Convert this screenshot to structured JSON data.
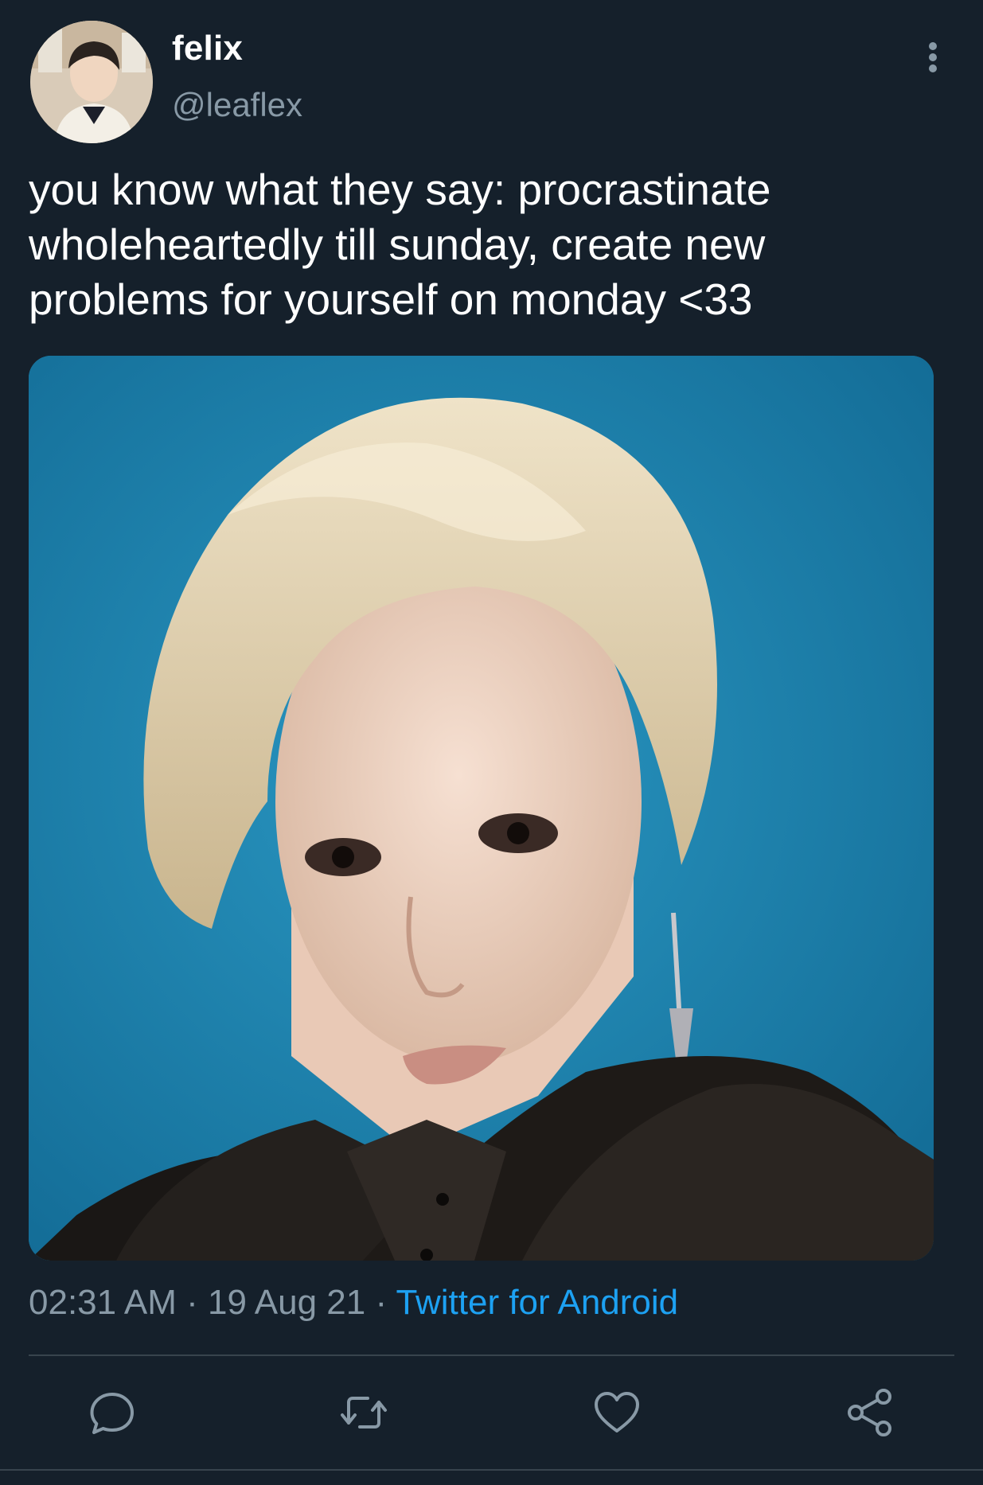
{
  "author": {
    "display_name": "felix",
    "handle": "@leaflex",
    "avatar_icon": "profile-photo"
  },
  "tweet": {
    "text": "you know what they say: procrastinate\nwholeheartedly till sunday, create new\nproblems for yourself on monday <33",
    "media": {
      "kind": "photo",
      "background_color": "#1f86b0"
    }
  },
  "meta": {
    "time": "02:31 AM",
    "separator": " · ",
    "date": "19 Aug 21",
    "source": "Twitter for Android"
  },
  "actions": [
    {
      "icon": "reply-icon"
    },
    {
      "icon": "retweet-icon"
    },
    {
      "icon": "like-icon"
    },
    {
      "icon": "share-icon"
    }
  ],
  "colors": {
    "background": "#15202b",
    "secondary_text": "#8899a6",
    "accent": "#1da1f2",
    "divider": "#38444d"
  }
}
